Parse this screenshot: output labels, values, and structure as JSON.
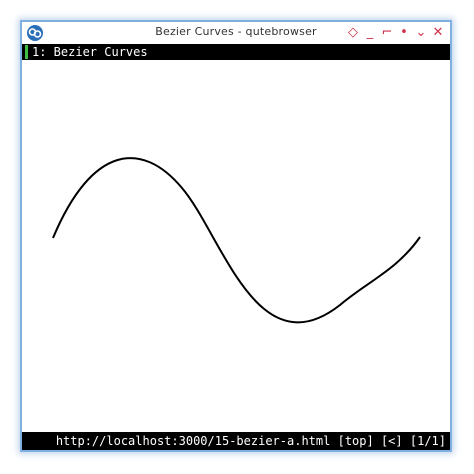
{
  "window": {
    "title": "Bezier Curves - qutebrowser",
    "controls": {
      "sticky": "◇",
      "minimize": "_",
      "maximize": "⌐",
      "menu": "•",
      "shade": "⌄",
      "close": "✕"
    },
    "accent_color": "#d0304a"
  },
  "tabbar": {
    "active_tab_label": "1: Bezier Curves",
    "indicator_color": "#3fbf3f"
  },
  "statusbar": {
    "url": "http://localhost:3000/15-bezier-a.html",
    "scroll": "[top]",
    "history": "[<]",
    "tab_count": "[1/1]"
  }
}
